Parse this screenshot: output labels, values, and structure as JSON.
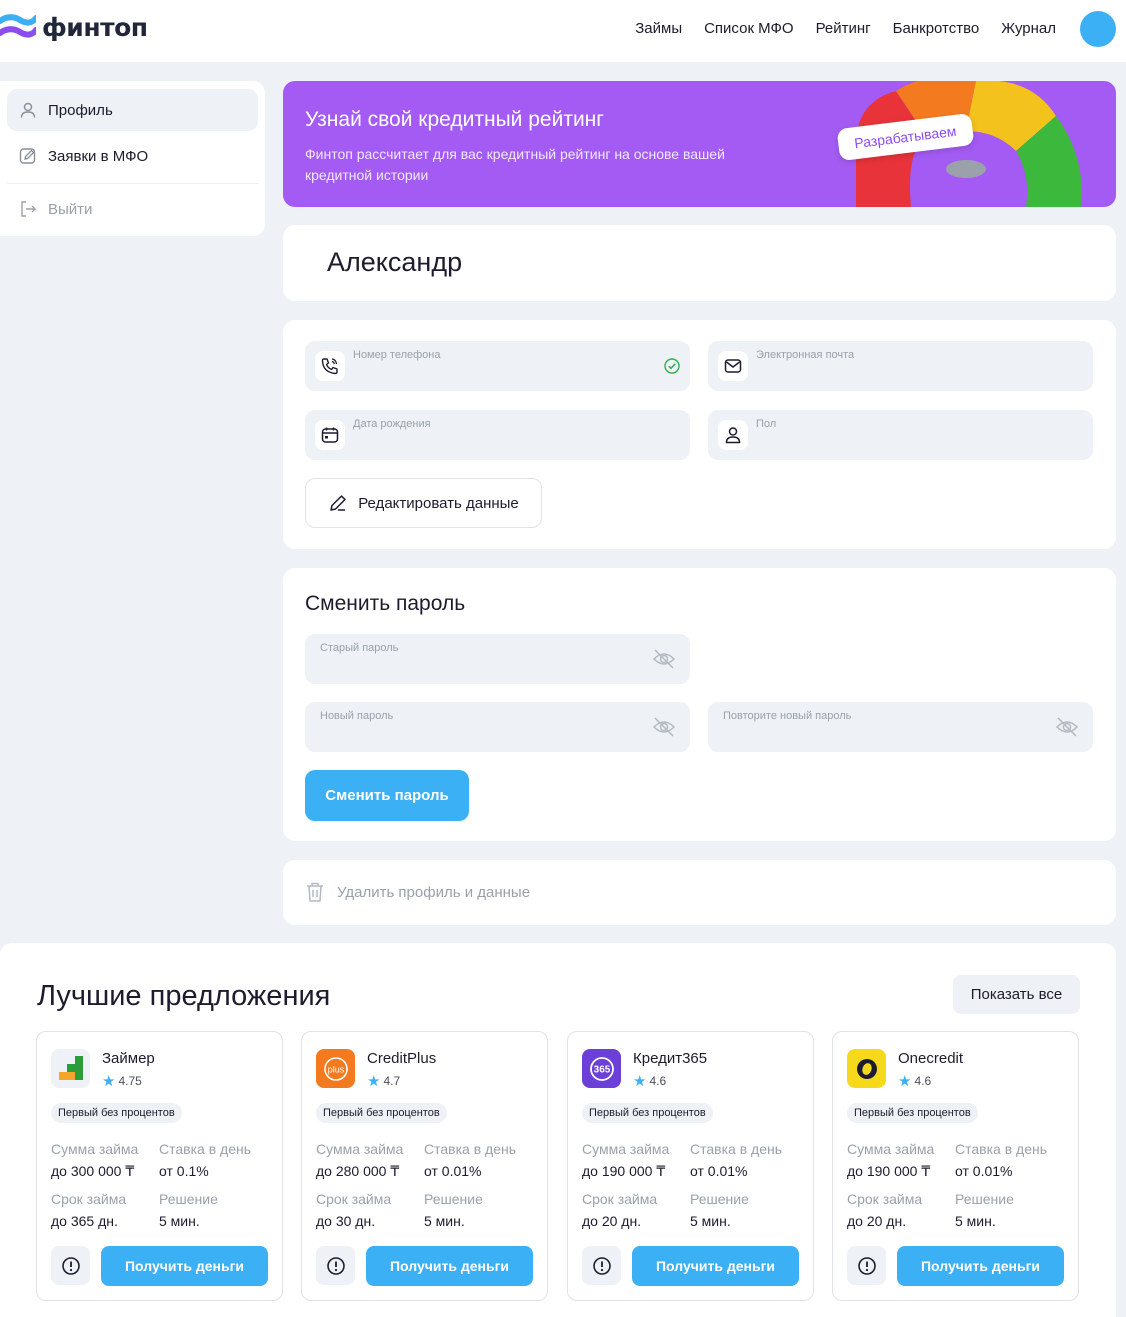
{
  "header": {
    "brand": "финтоп",
    "nav": [
      "Займы",
      "Список МФО",
      "Рейтинг",
      "Банкротство",
      "Журнал"
    ]
  },
  "sidebar": {
    "items": [
      {
        "label": "Профиль",
        "icon": "user-icon",
        "active": true
      },
      {
        "label": "Заявки в МФО",
        "icon": "edit-document-icon"
      },
      {
        "label": "Выйти",
        "icon": "logout-icon"
      }
    ]
  },
  "promo": {
    "title": "Узнай свой кредитный рейтинг",
    "description": "Финтоп рассчитает для вас кредитный рейтинг на основе вашей кредитной истории",
    "badge": "Разрабатываем"
  },
  "profile": {
    "name": "Александр",
    "phone_label": "Номер телефона",
    "email_label": "Электронная почта",
    "birthdate_label": "Дата рождения",
    "gender_label": "Пол",
    "edit_button": "Редактировать данные"
  },
  "password": {
    "title": "Сменить пароль",
    "old_label": "Старый пароль",
    "new_label": "Новый пароль",
    "repeat_label": "Повторите новый пароль",
    "submit": "Сменить пароль"
  },
  "delete": {
    "label": "Удалить профиль и данные"
  },
  "offers": {
    "title": "Лучшие предложения",
    "show_all": "Показать все",
    "labels": {
      "amount": "Сумма займа",
      "rate": "Ставка в день",
      "term": "Срок займа",
      "decision": "Решение",
      "button": "Получить деньги"
    },
    "items": [
      {
        "name": "Займер",
        "rating": "4.75",
        "tag": "Первый без процентов",
        "amount": "до 300 000 ₸",
        "rate": "от 0.1%",
        "term": "до 365 дн.",
        "decision": "5 мин."
      },
      {
        "name": "CreditPlus",
        "rating": "4.7",
        "tag": "Первый без процентов",
        "amount": "до 280 000 ₸",
        "rate": "от 0.01%",
        "term": "до 30 дн.",
        "decision": "5 мин."
      },
      {
        "name": "Кредит365",
        "rating": "4.6",
        "tag": "Первый без процентов",
        "amount": "до 190 000 ₸",
        "rate": "от 0.01%",
        "term": "до 20 дн.",
        "decision": "5 мин."
      },
      {
        "name": "Onecredit",
        "rating": "4.6",
        "tag": "Первый без процентов",
        "amount": "до 190 000 ₸",
        "rate": "от 0.01%",
        "term": "до 20 дн.",
        "decision": "5 мин."
      }
    ]
  },
  "colors": {
    "accent": "#3bb0f5",
    "promo": "#a35bf3",
    "background": "#eef1f5",
    "star": "#3bb0f5",
    "check": "#2db24a"
  }
}
